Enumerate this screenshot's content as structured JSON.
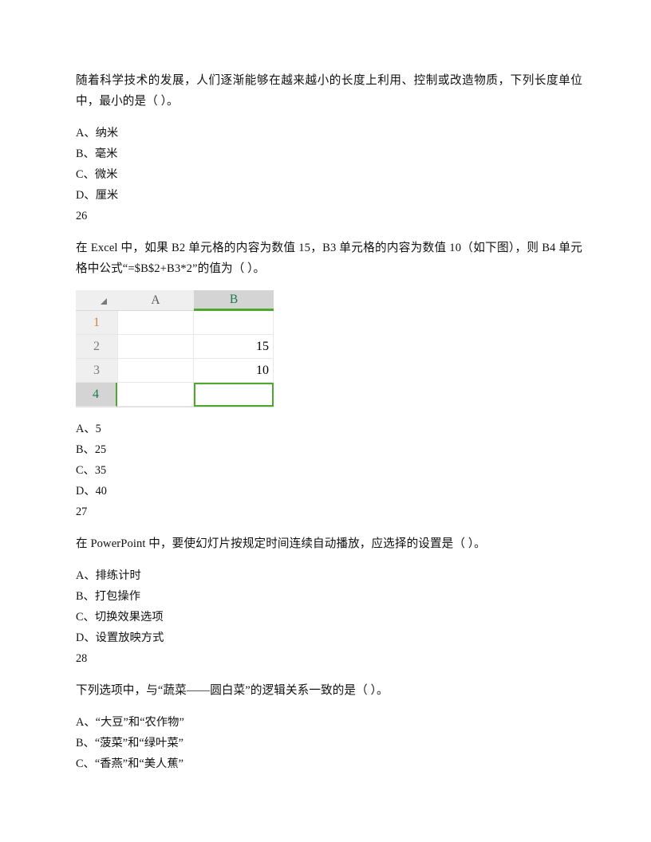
{
  "document": {
    "questions": [
      {
        "id": "q25",
        "stem": "随着科学技术的发展，人们逐渐能够在越来越小的长度上利用、控制或改造物质，下列长度单位中，最小的是（  ）。",
        "options": [
          "A、纳米",
          "B、毫米",
          "C、微米",
          "D、厘米"
        ],
        "next_number": "26"
      },
      {
        "id": "q26",
        "stem": "在 Excel 中，如果 B2 单元格的内容为数值 15，B3 单元格的内容为数值 10（如下图），则 B4 单元格中公式“=$B$2+B3*2”的值为（  ）。",
        "options": [
          "A、5",
          "B、25",
          "C、35",
          "D、40"
        ],
        "next_number": "27"
      },
      {
        "id": "q27",
        "stem": "在 PowerPoint 中，要使幻灯片按规定时间连续自动播放，应选择的设置是（  ）。",
        "options": [
          "A、排练计时",
          "B、打包操作",
          "C、切换效果选项",
          "D、设置放映方式"
        ],
        "next_number": "28"
      },
      {
        "id": "q28",
        "stem": "下列选项中，与“蔬菜——圆白菜”的逻辑关系一致的是（  ）。",
        "options": [
          "A、“大豆”和“农作物”",
          "B、“菠菜”和“绿叶菜”",
          "C、“香燕”和“美人蕉”"
        ],
        "next_number": ""
      }
    ]
  },
  "spreadsheet": {
    "select_all_icon": "select-all-triangle-icon",
    "column_headers": [
      "A",
      "B"
    ],
    "selected_column": "B",
    "row_headers": [
      "1",
      "2",
      "3",
      "4"
    ],
    "selected_row": "4",
    "active_cell": "B4",
    "rows": [
      {
        "header": "1",
        "A": "",
        "B": ""
      },
      {
        "header": "2",
        "A": "",
        "B": "15"
      },
      {
        "header": "3",
        "A": "",
        "B": "10"
      },
      {
        "header": "4",
        "A": "",
        "B": ""
      }
    ],
    "colors": {
      "selection_green": "#4ea72e",
      "header_bg": "#efefef",
      "header_selected_bg": "#d4d4d4",
      "gridline": "#e8e8e8",
      "row1_label_color": "#d2803a"
    }
  }
}
